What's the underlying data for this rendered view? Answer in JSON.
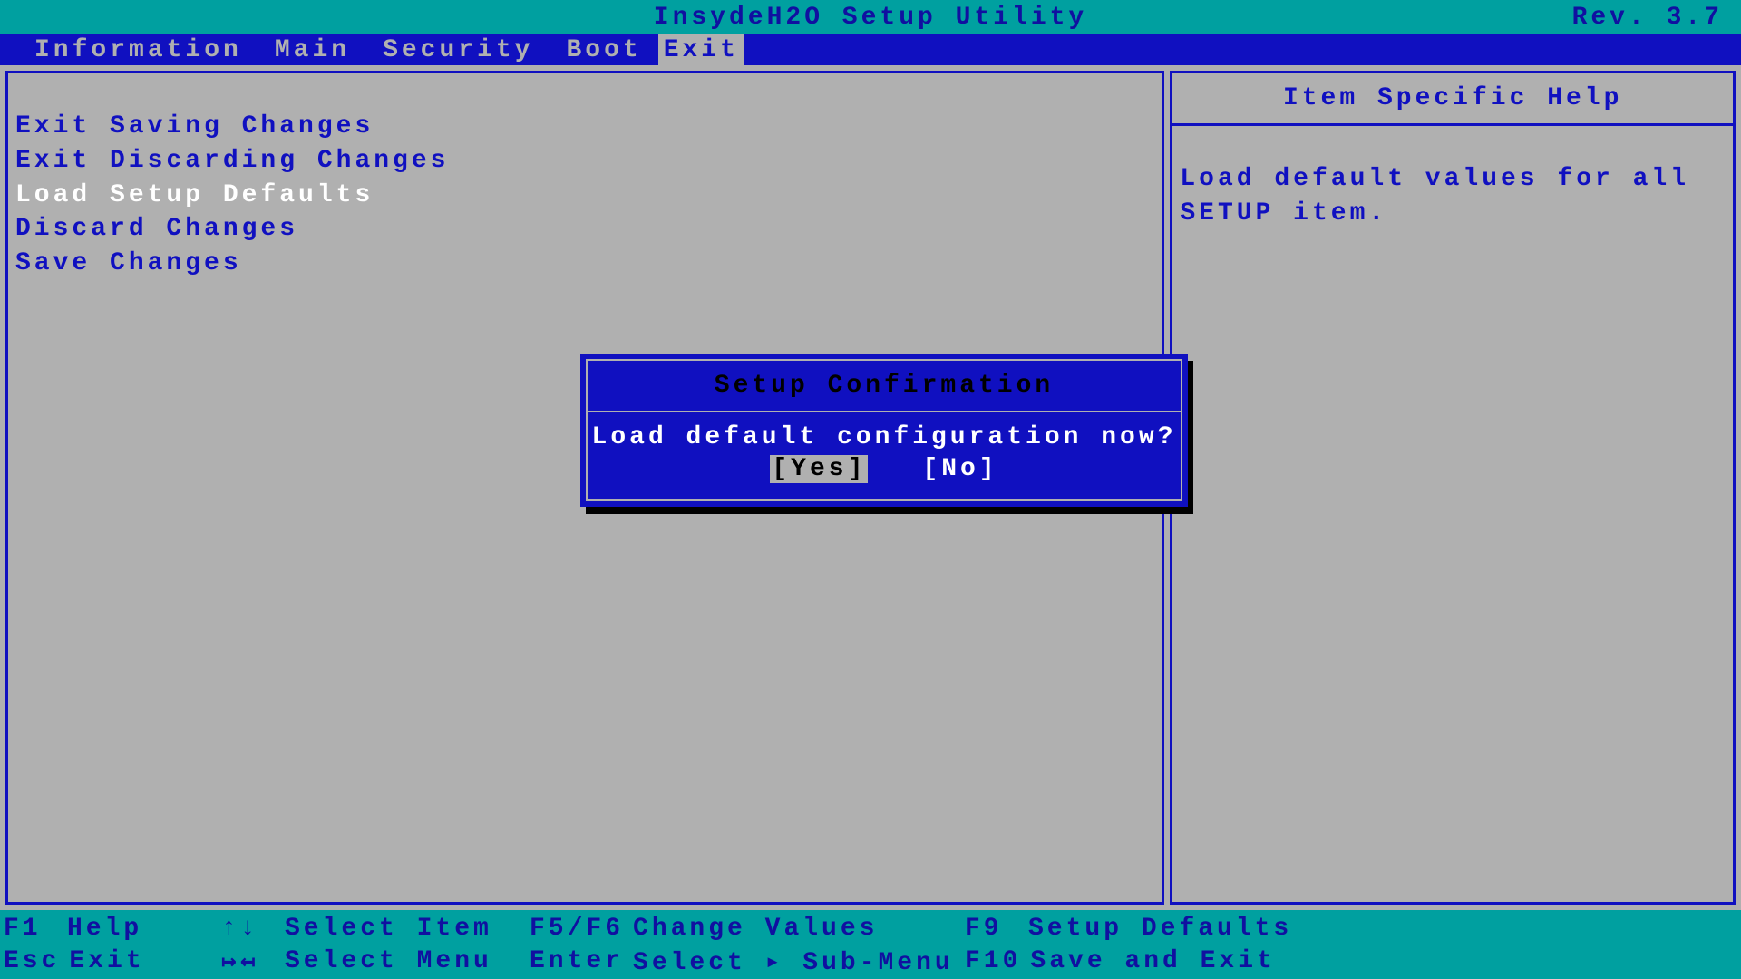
{
  "header": {
    "title": "InsydeH2O Setup Utility",
    "version": "Rev. 3.7"
  },
  "tabs": [
    {
      "label": "Information",
      "selected": false
    },
    {
      "label": "Main",
      "selected": false
    },
    {
      "label": "Security",
      "selected": false
    },
    {
      "label": "Boot",
      "selected": false
    },
    {
      "label": "Exit",
      "selected": true
    }
  ],
  "menu": {
    "items": [
      {
        "label": "Exit Saving Changes",
        "selected": false
      },
      {
        "label": "Exit Discarding Changes",
        "selected": false
      },
      {
        "label": "Load Setup Defaults",
        "selected": true
      },
      {
        "label": "Discard Changes",
        "selected": false
      },
      {
        "label": "Save Changes",
        "selected": false
      }
    ]
  },
  "help": {
    "header": "Item Specific Help",
    "body": "Load default values for all SETUP item."
  },
  "dialog": {
    "title": "Setup Confirmation",
    "message": "Load default configuration now?",
    "yes": "[Yes]",
    "no": "[No]"
  },
  "footer": {
    "f1": {
      "key": "F1",
      "label": "Help"
    },
    "esc": {
      "key": "Esc",
      "label": "Exit"
    },
    "updown": {
      "key": "↑↓",
      "label": "Select Item"
    },
    "leftright": {
      "key": "↦↤",
      "label": "Select Menu"
    },
    "f5f6": {
      "key": "F5/F6",
      "label": "Change Values"
    },
    "enter": {
      "key": "Enter",
      "label": "Select ▸ Sub-Menu"
    },
    "f9": {
      "key": "F9",
      "label": "Setup Defaults"
    },
    "f10": {
      "key": "F10",
      "label": "Save and Exit"
    }
  }
}
